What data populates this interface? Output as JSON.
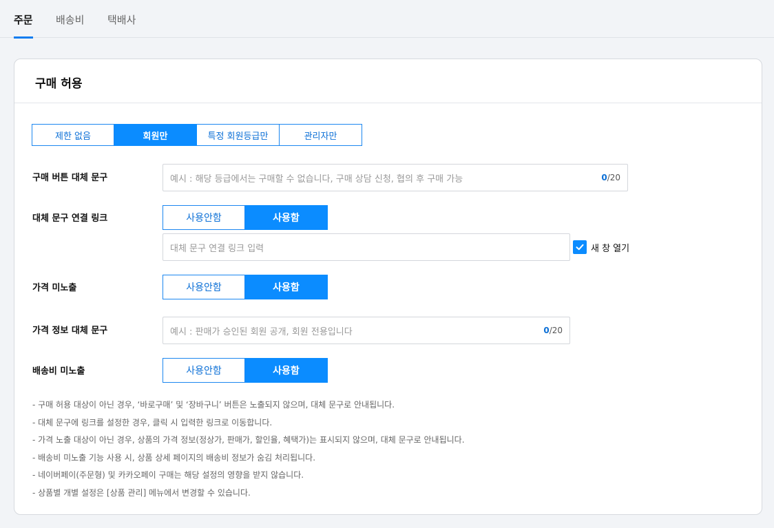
{
  "tabs": [
    {
      "label": "주문",
      "active": true
    },
    {
      "label": "배송비",
      "active": false
    },
    {
      "label": "택배사",
      "active": false
    }
  ],
  "card": {
    "title": "구매 허용",
    "purchase_scope": {
      "options": [
        "제한 없음",
        "회원만",
        "특정 회원등급만",
        "관리자만"
      ],
      "selected": "회원만"
    },
    "buy_button_text": {
      "label": "구매 버튼 대체 문구",
      "placeholder": "예시 : 해당 등급에서는 구매할 수 없습니다, 구매 상담 신청, 협의 후 구매 가능",
      "count": "0",
      "max": "/20"
    },
    "alt_link": {
      "label": "대체 문구 연결 링크",
      "off": "사용안함",
      "on": "사용함",
      "selected": "사용함",
      "placeholder": "대체 문구 연결 링크 입력",
      "new_window_label": "새 창 열기",
      "new_window_checked": true
    },
    "hide_price": {
      "label": "가격 미노출",
      "off": "사용안함",
      "on": "사용함",
      "selected": "사용함"
    },
    "price_text": {
      "label": "가격 정보 대체 문구",
      "placeholder": "예시 : 판매가 승인된 회원 공개, 회원 전용입니다",
      "count": "0",
      "max": "/20"
    },
    "hide_shipping": {
      "label": "배송비 미노출",
      "off": "사용안함",
      "on": "사용함",
      "selected": "사용함"
    },
    "notes": [
      "-  구매 허용 대상이 아닌 경우, ‘바로구매’ 및 ‘장바구니’ 버튼은 노출되지 않으며, 대체 문구로 안내됩니다.",
      "-  대체 문구에 링크를 설정한 경우, 클릭 시 입력한 링크로 이동합니다.",
      "-  가격 노출 대상이 아닌 경우, 상품의 가격 정보(정상가, 판매가, 할인율, 혜택가)는 표시되지 않으며, 대체 문구로 안내됩니다.",
      "-  배송비 미노출 기능 사용 시, 상품 상세 페이지의 배송비 정보가 숨김 처리됩니다.",
      "-  네이버페이(주문형) 및 카카오페이 구매는 해당 설정의 영향을 받지 않습니다.",
      "-  상품별 개별 설정은 [상품 관리] 메뉴에서 변경할 수 있습니다."
    ]
  },
  "colors": {
    "accent": "#0b8cff",
    "tab_underline": "#0b7cf0",
    "page_bg": "#f2f4f7"
  }
}
